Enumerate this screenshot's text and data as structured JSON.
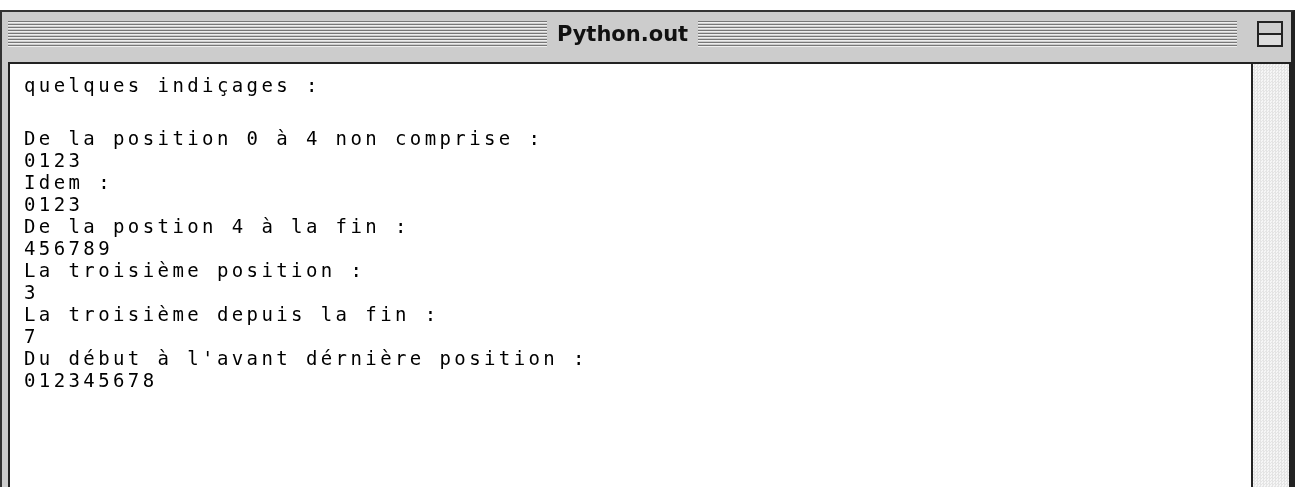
{
  "window": {
    "title": "Python.out"
  },
  "output": {
    "heading": "quelques indiçages :",
    "lines": [
      "De la position 0 à 4 non comprise :",
      "0123",
      "Idem :",
      "0123",
      "De la postion 4 à la fin :",
      "456789",
      "La troisième position :",
      "3",
      "La troisième depuis la fin :",
      "7",
      "Du début à l'avant dérnière position :",
      "012345678"
    ]
  }
}
